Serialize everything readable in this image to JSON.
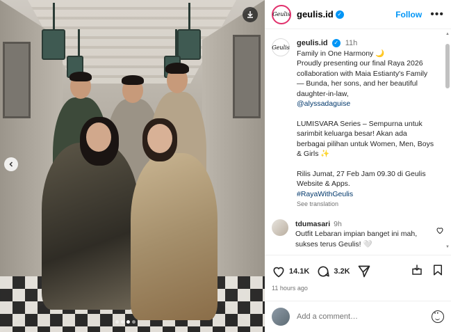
{
  "photo": {
    "download_icon": "download-icon",
    "prev_icon": "chevron-left-icon",
    "carousel_dots": 4,
    "active_dot": 2
  },
  "header": {
    "avatar_text": "Geulis",
    "username": "geulis.id",
    "verified": "✓",
    "follow_label": "Follow",
    "more_label": "•••"
  },
  "caption": {
    "username": "geulis.id",
    "time": "11h",
    "line1": "Family in One Harmony 🌙",
    "line2": "Proudly presenting our final Raya 2026 collaboration with Maia Estianty's Family — Bunda, her sons, and her beautiful daughter-in-law,",
    "mention": "@alyssadaguise",
    "para2": "LUMISVARA Series – Sempurna untuk sarimbit keluarga besar! Akan ada berbagai pilihan untuk Women, Men, Boys & Girls ✨",
    "para3": "Rilis Jumat, 27 Feb Jam 09.30 di Geulis Website & Apps.",
    "hashtag": "#RayaWithGeulis",
    "see_translation": "See translation"
  },
  "comment": {
    "username": "tdumasari",
    "time": "9h",
    "text": "Outfit Lebaran impian banget ini mah, sukses terus Geulis! 🤍"
  },
  "actions": {
    "likes": "14.1K",
    "comments": "3.2K",
    "posted_ago": "11 hours ago"
  },
  "add_comment": {
    "placeholder": "Add a comment…"
  }
}
